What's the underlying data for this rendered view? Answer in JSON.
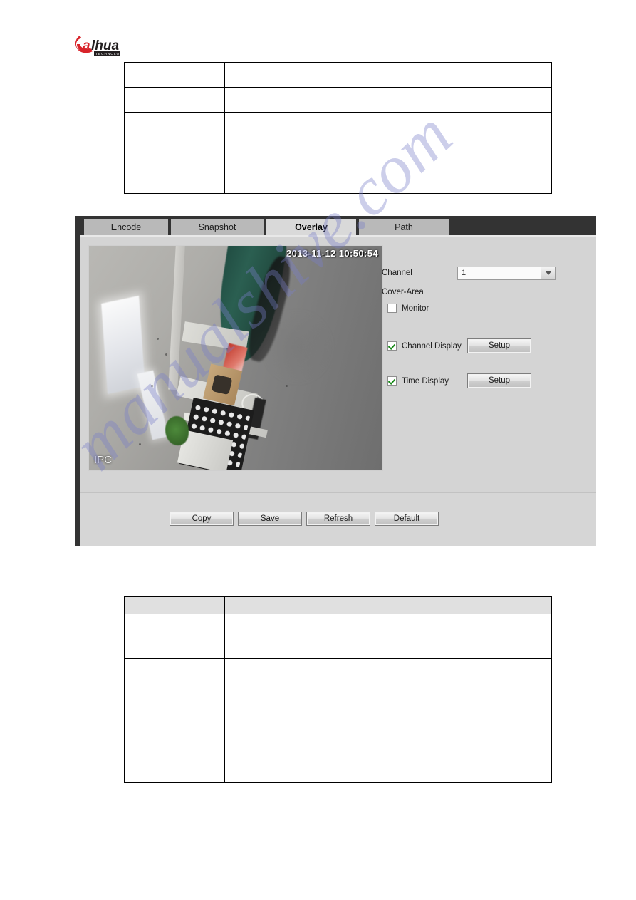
{
  "brand": {
    "logo_text": "alhua",
    "logo_sub": "TECHNOLOGY",
    "logo_red": "#D8232A",
    "logo_dark": "#231F20"
  },
  "watermark": {
    "text": "manualshive.com"
  },
  "top_table": {
    "columns": [
      "",
      ""
    ],
    "rows": [
      {
        "cells": [
          "",
          ""
        ]
      },
      {
        "cells": [
          "",
          ""
        ]
      },
      {
        "cells": [
          "",
          ""
        ]
      },
      {
        "cells": [
          "",
          ""
        ]
      }
    ]
  },
  "bottom_table": {
    "header": [
      "",
      ""
    ],
    "rows": [
      {
        "cells": [
          "",
          ""
        ]
      },
      {
        "cells": [
          "",
          ""
        ]
      },
      {
        "cells": [
          "",
          ""
        ]
      }
    ]
  },
  "window": {
    "tabs": [
      {
        "label": "Encode",
        "active": false
      },
      {
        "label": "Snapshot",
        "active": false
      },
      {
        "label": "Overlay",
        "active": true
      },
      {
        "label": "Path",
        "active": false
      }
    ],
    "preview": {
      "timestamp": "2013-11-12 10:50:54",
      "channel_title": "IPC"
    },
    "settings": {
      "channel_label": "Channel",
      "channel_value": "1",
      "channel_placeholder": "1",
      "cover_area_label": "Cover-Area",
      "monitor_label": "Monitor",
      "monitor_checked": false,
      "channel_display_label": "Channel Display",
      "channel_display_checked": true,
      "channel_display_setup": "Setup",
      "time_display_label": "Time Display",
      "time_display_checked": true,
      "time_display_setup": "Setup"
    },
    "actions": [
      {
        "label": "Copy"
      },
      {
        "label": "Save"
      },
      {
        "label": "Refresh"
      },
      {
        "label": "Default"
      }
    ]
  }
}
